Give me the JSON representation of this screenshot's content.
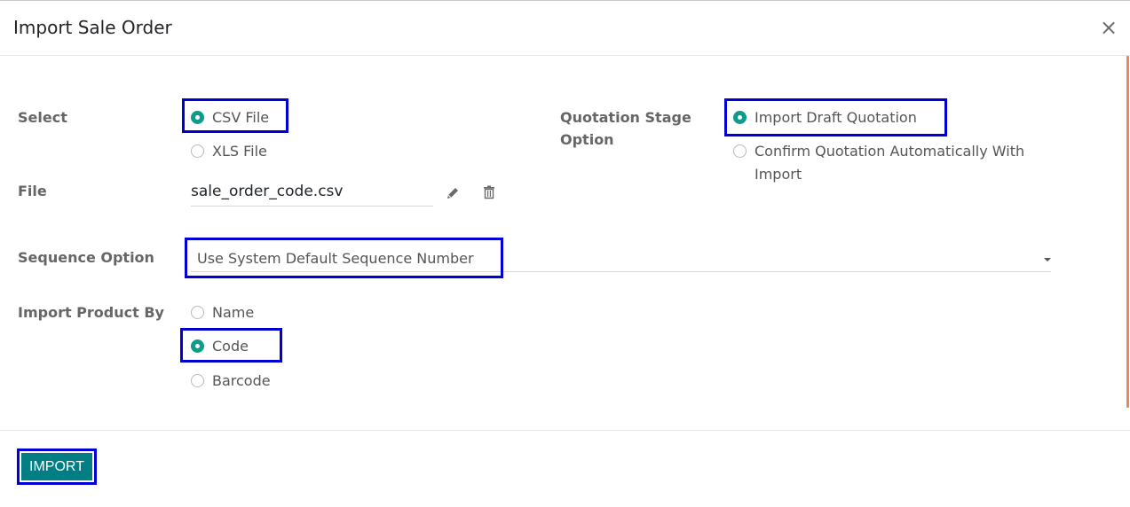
{
  "dialog": {
    "title": "Import Sale Order",
    "close_glyph": "×"
  },
  "select": {
    "label": "Select",
    "options": [
      {
        "label": "CSV File",
        "checked": true
      },
      {
        "label": "XLS File",
        "checked": false
      }
    ]
  },
  "file": {
    "label": "File",
    "value": "sale_order_code.csv",
    "edit_icon": "pencil-icon",
    "delete_icon": "trash-icon"
  },
  "quotation_stage": {
    "label_line1": "Quotation Stage",
    "label_line2": "Option",
    "options": [
      {
        "label": "Import Draft Quotation",
        "checked": true
      },
      {
        "label_line1": "Confirm Quotation Automatically With",
        "label_line2": "Import",
        "checked": false
      }
    ]
  },
  "sequence": {
    "label": "Sequence Option",
    "value": "Use System Default Sequence Number"
  },
  "import_product_by": {
    "label": "Import Product By",
    "options": [
      {
        "label": "Name",
        "checked": false
      },
      {
        "label": "Code",
        "checked": true
      },
      {
        "label": "Barcode",
        "checked": false
      }
    ]
  },
  "footer": {
    "import_label": "IMPORT"
  },
  "colors": {
    "accent": "#017e84",
    "radio_checked": "#0e9c8c",
    "highlight_box": "#0000d6",
    "scrollbar": "#f0845c"
  }
}
